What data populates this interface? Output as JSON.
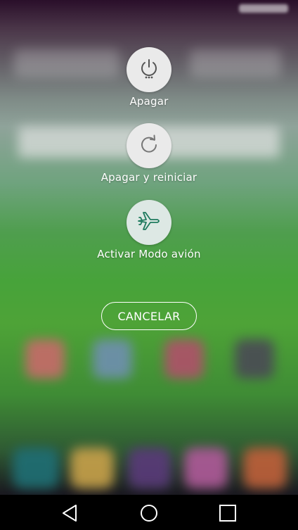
{
  "power_menu": {
    "options": [
      {
        "label": "Apagar",
        "icon": "power-icon"
      },
      {
        "label": "Apagar y reiniciar",
        "icon": "restart-icon"
      },
      {
        "label": "Activar Modo avión",
        "icon": "airplane-icon"
      }
    ],
    "cancel_label": "CANCELAR"
  },
  "nav_bar": {
    "buttons": [
      "back-icon",
      "home-icon",
      "recents-icon"
    ]
  },
  "colors": {
    "accent_teal": "#1e7a5e",
    "icon_gray": "#555555",
    "circle_bg": "#eaeaea"
  }
}
